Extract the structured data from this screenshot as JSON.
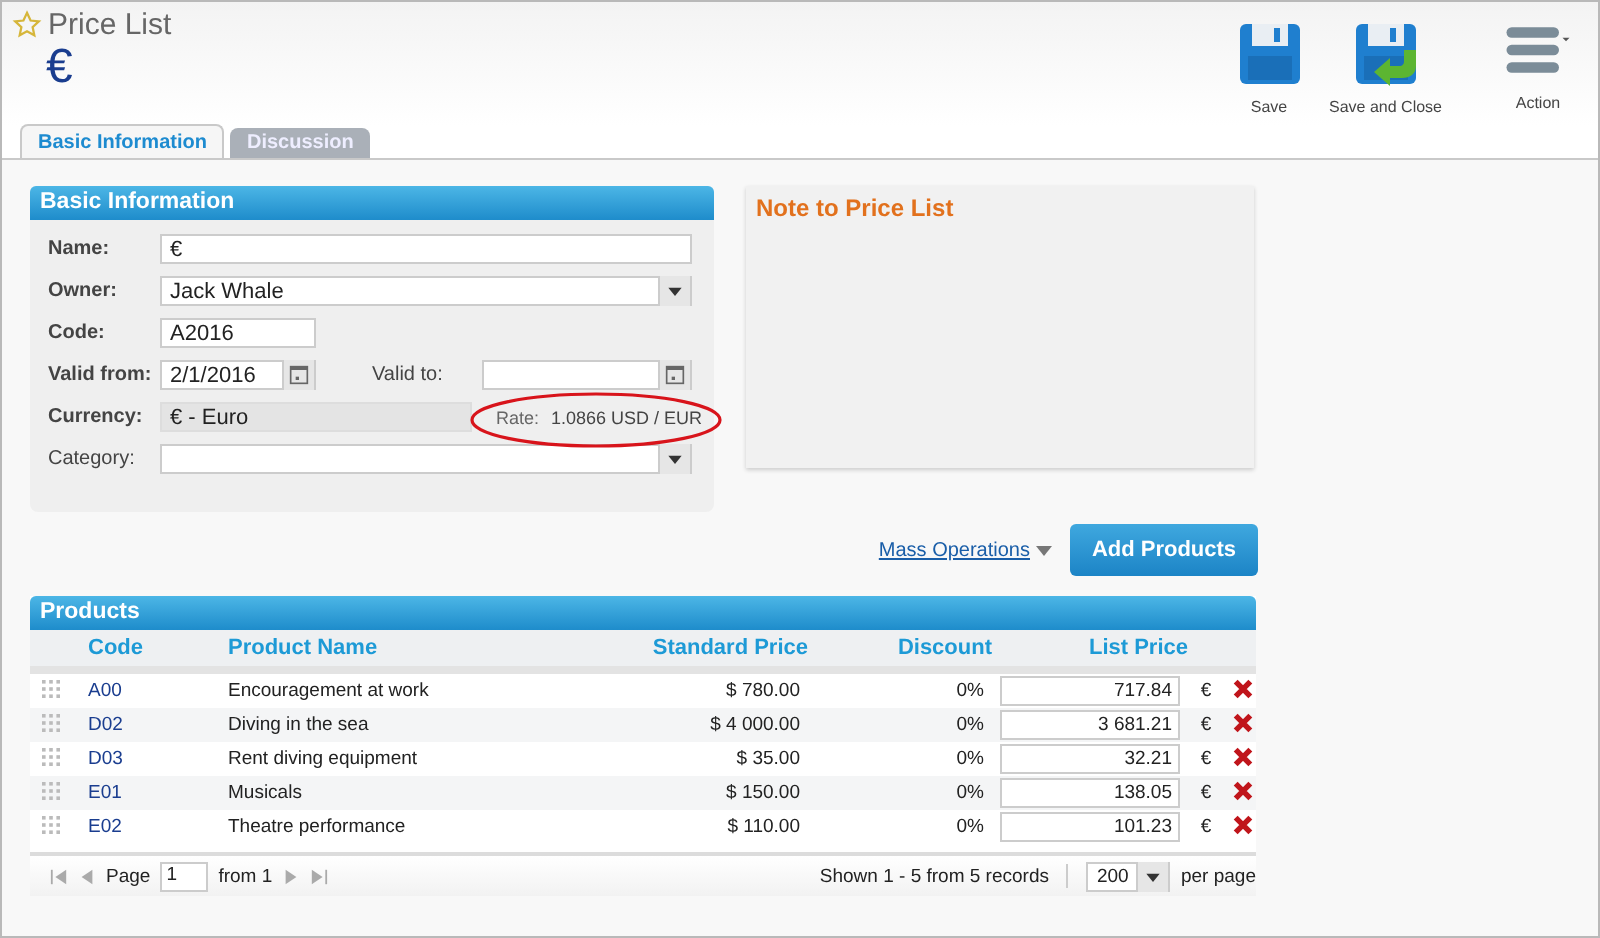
{
  "page": {
    "title": "Price List",
    "symbol": "€",
    "starred": false
  },
  "toolbar": [
    {
      "label": "Save",
      "kind": "save"
    },
    {
      "label": "Save and Close",
      "kind": "save_close"
    },
    {
      "label": "Action",
      "kind": "menu"
    }
  ],
  "tabs": [
    {
      "label": "Basic Information",
      "selected": true
    },
    {
      "label": "Discussion",
      "selected": false
    }
  ],
  "basic_info": {
    "title": "Basic Information",
    "name": {
      "label": "Name:",
      "value": "€"
    },
    "owner": {
      "label": "Owner:",
      "value": "Jack Whale"
    },
    "code": {
      "label": "Code:",
      "value": "A2016"
    },
    "valid_from": {
      "label": "Valid from:",
      "value": "2/1/2016"
    },
    "valid_to": {
      "label": "Valid to:"
    },
    "currency": {
      "label": "Currency:",
      "value": "€ - Euro"
    },
    "rate": {
      "label": "Rate:",
      "value": "1.0866 USD / EUR",
      "highlighted": true
    },
    "category": {
      "label": "Category:"
    }
  },
  "note": {
    "title": "Note to Price List"
  },
  "mass_operations": "Mass Operations",
  "add_products": "Add Products",
  "products": {
    "title": "Products",
    "columns": [
      "Code",
      "Product Name",
      "Standard Price",
      "Discount",
      "List Price"
    ],
    "rows": [
      {
        "code": "A00",
        "name": "Encouragement at work",
        "standard_price": "$ 780.00",
        "discount": "0%",
        "list_price": "717.84",
        "currency": "€"
      },
      {
        "code": "D02",
        "name": "Diving in the sea",
        "standard_price": "$ 4 000.00",
        "discount": "0%",
        "list_price": "3 681.21",
        "currency": "€"
      },
      {
        "code": "D03",
        "name": "Rent diving equipment",
        "standard_price": "$ 35.00",
        "discount": "0%",
        "list_price": "32.21",
        "currency": "€"
      },
      {
        "code": "E01",
        "name": "Musicals",
        "standard_price": "$ 150.00",
        "discount": "0%",
        "list_price": "138.05",
        "currency": "€"
      },
      {
        "code": "E02",
        "name": "Theatre performance",
        "standard_price": "$ 110.00",
        "discount": "0%",
        "list_price": "101.23",
        "currency": "€"
      }
    ]
  },
  "pager": {
    "page_label": "Page",
    "page": "1",
    "from": "from 1",
    "shown": "Shown 1 - 5 from 5 records",
    "per_page": "200",
    "per_page_label": "per page"
  }
}
